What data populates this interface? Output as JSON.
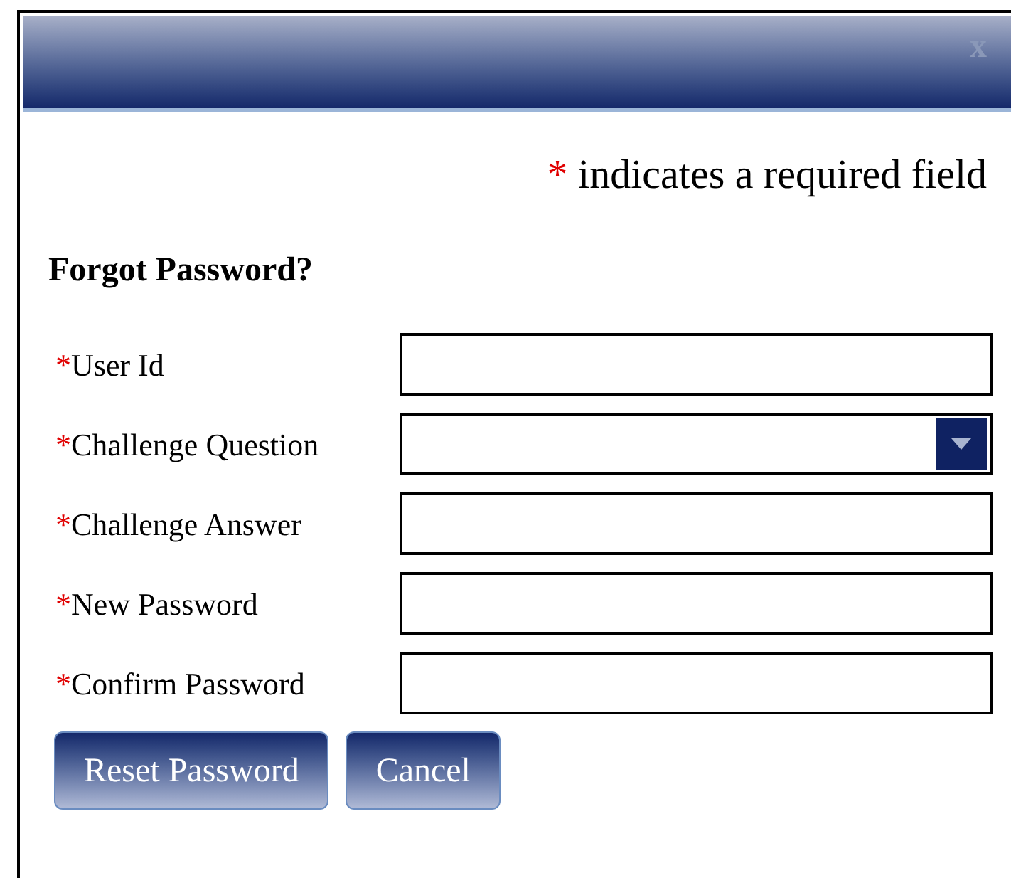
{
  "dialog": {
    "close_label": "x"
  },
  "required_note": {
    "marker": "*",
    "text": "indicates a required field"
  },
  "heading": "Forgot Password?",
  "fields": [
    {
      "kind": "text",
      "marker": "*",
      "label": "User Id"
    },
    {
      "kind": "select",
      "marker": "*",
      "label": "Challenge Question"
    },
    {
      "kind": "text",
      "marker": "*",
      "label": "Challenge Answer"
    },
    {
      "kind": "text",
      "marker": "*",
      "label": "New Password"
    },
    {
      "kind": "text",
      "marker": "*",
      "label": "Confirm Password"
    }
  ],
  "buttons": [
    "Reset Password",
    "Cancel"
  ]
}
